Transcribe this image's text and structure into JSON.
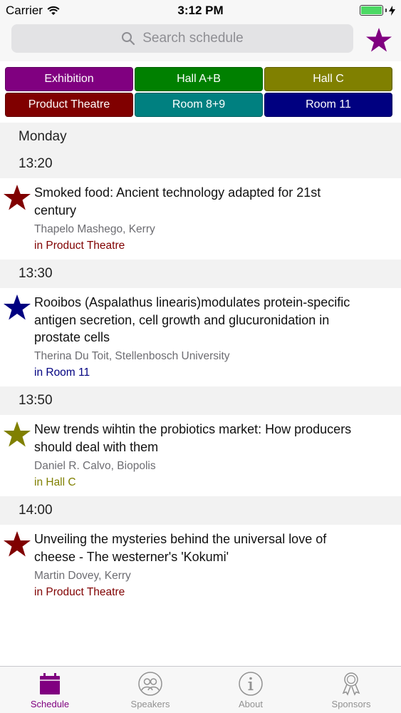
{
  "status": {
    "carrier": "Carrier",
    "time": "3:12 PM",
    "battery_level": 1.0,
    "battery_color": "#4cd964"
  },
  "search": {
    "placeholder": "Search schedule",
    "favorites_star_color": "#800080"
  },
  "filters": [
    {
      "label": "Exhibition",
      "color": "#800080"
    },
    {
      "label": "Hall A+B",
      "color": "#008000"
    },
    {
      "label": "Hall C",
      "color": "#808000"
    },
    {
      "label": "Product Theatre",
      "color": "#800000"
    },
    {
      "label": "Room 8+9",
      "color": "#008080"
    },
    {
      "label": "Room 11",
      "color": "#000080"
    }
  ],
  "schedule": {
    "day": "Monday",
    "slots": [
      {
        "time": "13:20",
        "star_color": "#800000",
        "title_line1": "Smoked food: Ancient technology adapted for 21st",
        "title_line2": "century",
        "title_line3": "",
        "speaker": "Thapelo Mashego, Kerry",
        "room": "in Product Theatre",
        "room_color": "#800000"
      },
      {
        "time": "13:30",
        "star_color": "#000080",
        "title_line1": "Rooibos (Aspalathus linearis)modulates protein-specific",
        "title_line2": "antigen secretion, cell growth and glucuronidation in",
        "title_line3": "prostate cells",
        "speaker": "Therina Du Toit, Stellenbosch University",
        "room": "in Room 11",
        "room_color": "#000080"
      },
      {
        "time": "13:50",
        "star_color": "#808000",
        "title_line1": "New trends wihtin the probiotics market: How producers",
        "title_line2": "should deal with them",
        "title_line3": "",
        "speaker": "Daniel R. Calvo, Biopolis",
        "room": "in Hall C",
        "room_color": "#808000"
      },
      {
        "time": "14:00",
        "star_color": "#800000",
        "title_line1": "Unveiling the mysteries behind the universal love of",
        "title_line2": "cheese - The westerner's 'Kokumi'",
        "title_line3": "",
        "speaker": "Martin Dovey, Kerry",
        "room": "in Product Theatre",
        "room_color": "#800000"
      }
    ]
  },
  "tabs": [
    {
      "label": "Schedule",
      "icon": "calendar-icon",
      "active": true
    },
    {
      "label": "Speakers",
      "icon": "speakers-icon",
      "active": false
    },
    {
      "label": "About",
      "icon": "info-icon",
      "active": false
    },
    {
      "label": "Sponsors",
      "icon": "award-ribbon-icon",
      "active": false
    }
  ],
  "active_tab_color": "#800080",
  "inactive_tab_color": "#929292"
}
